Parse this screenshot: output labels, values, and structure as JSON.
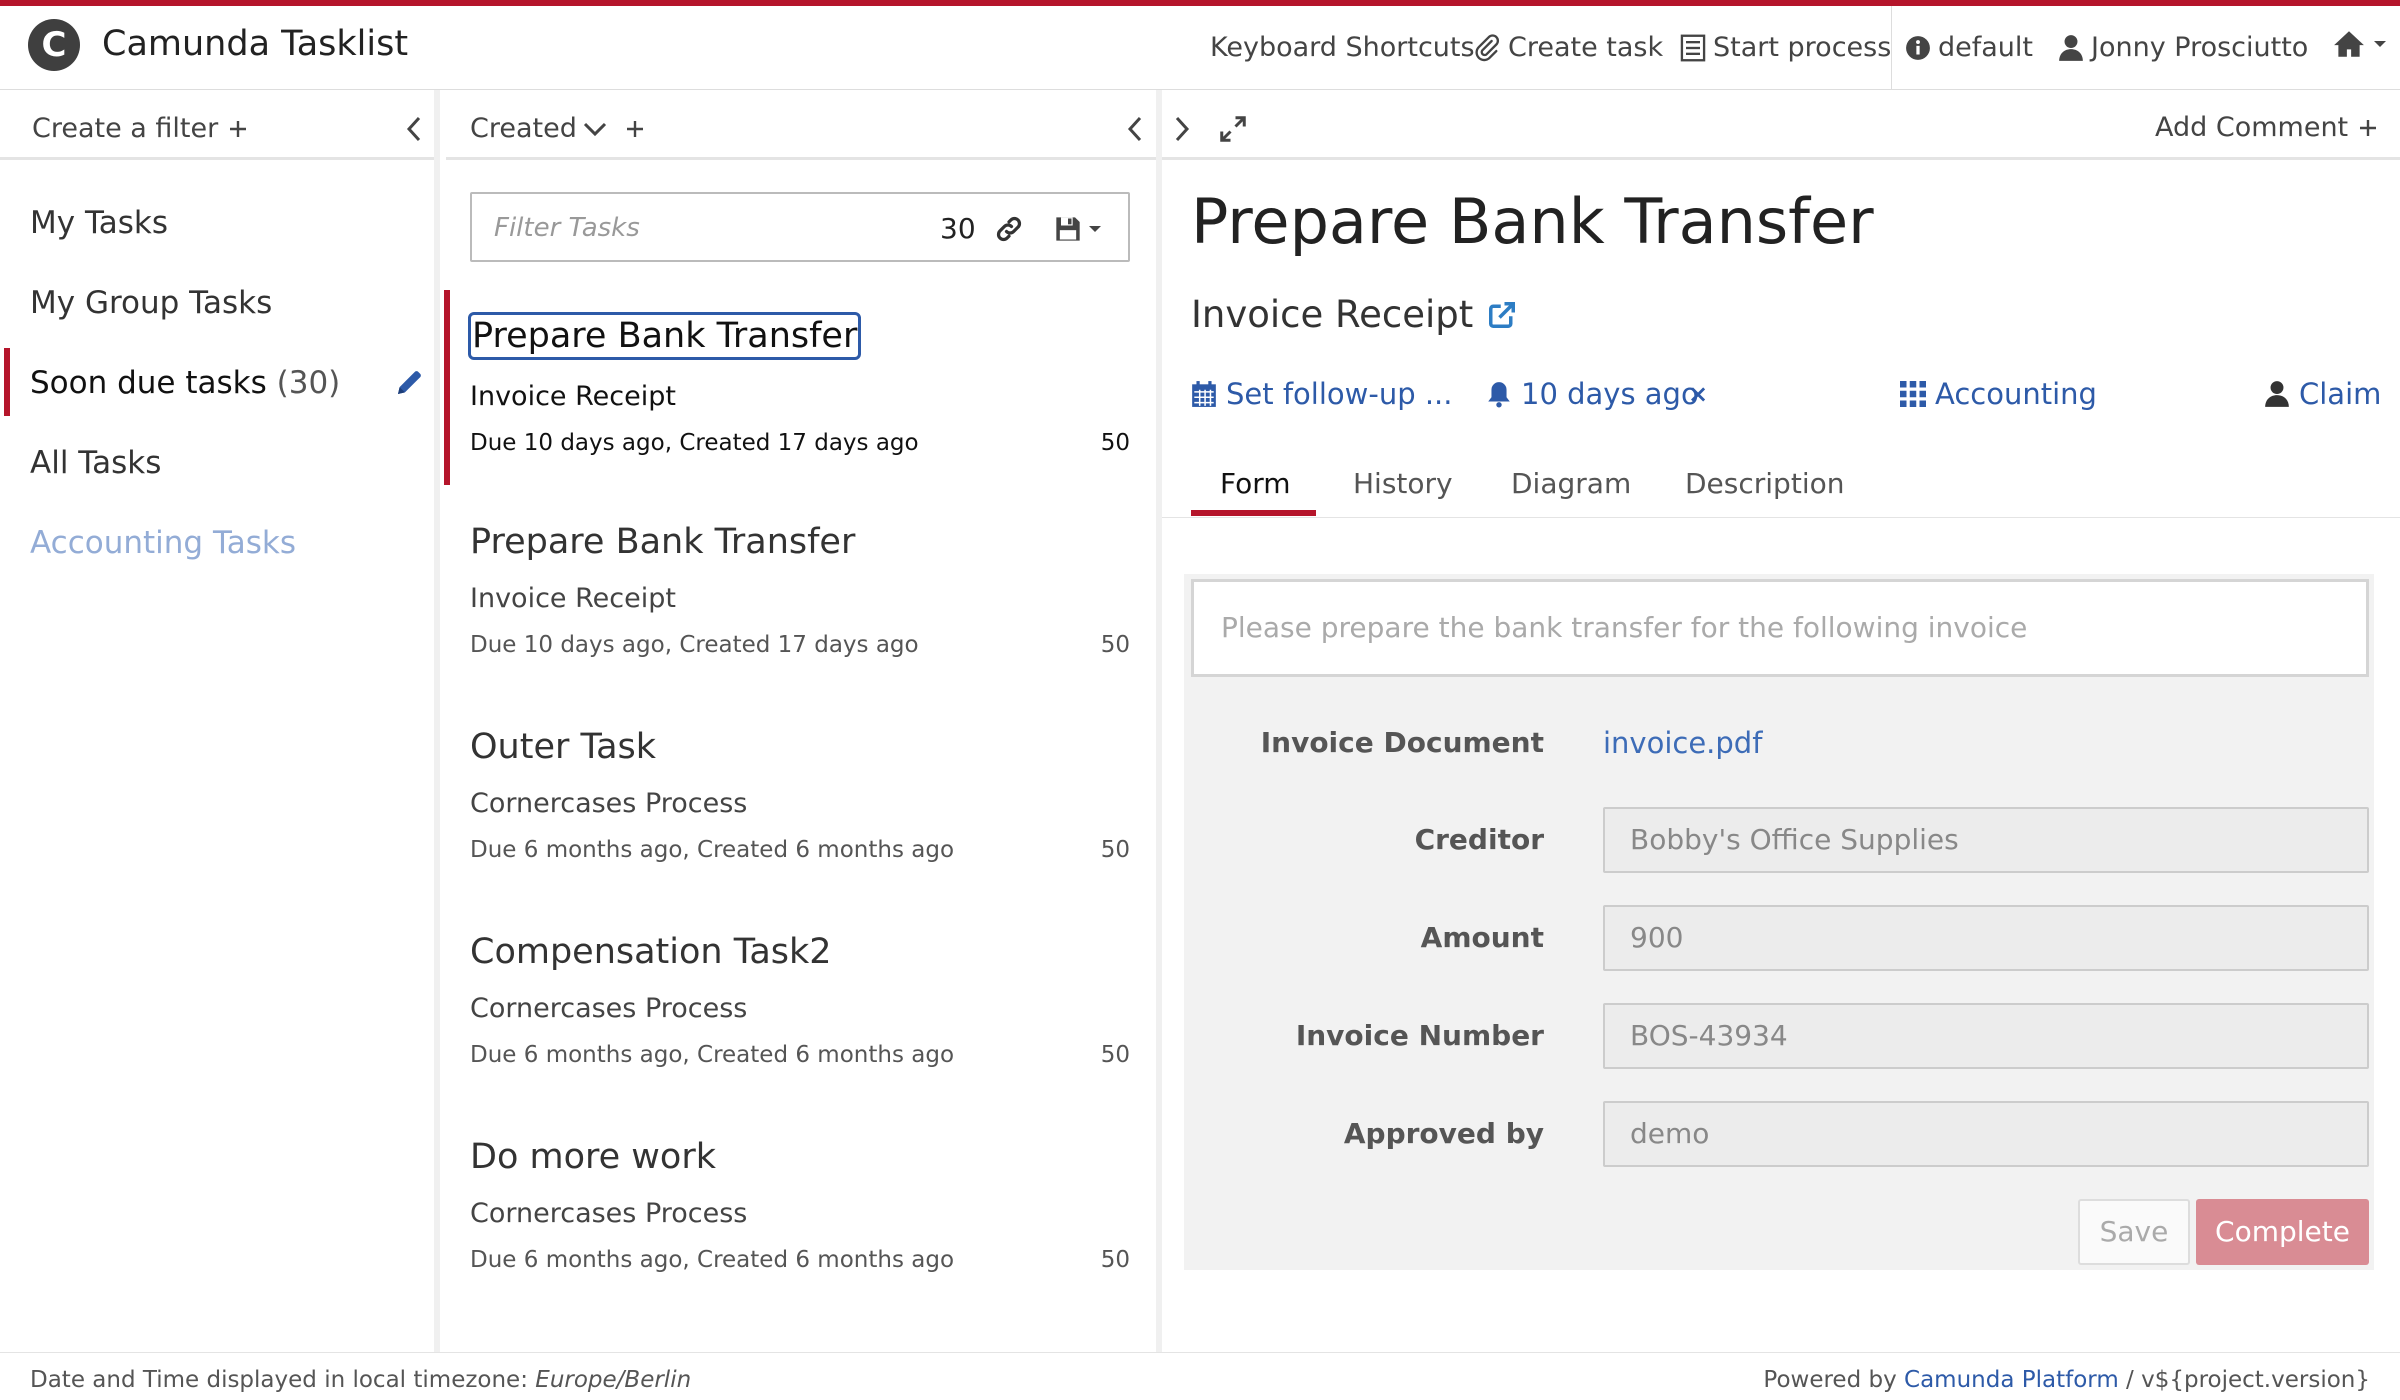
{
  "header": {
    "title": "Camunda Tasklist",
    "logo_letter": "C",
    "nav": {
      "keyboard_shortcuts": "Keyboard Shortcuts",
      "create_task": "Create task",
      "start_process": "Start process",
      "tenant": "default",
      "user": "Jonny Prosciutto"
    }
  },
  "filters": {
    "create_label": "Create a filter",
    "items": [
      {
        "label": "My Tasks"
      },
      {
        "label": "My Group Tasks"
      },
      {
        "label": "Soon due tasks",
        "count": "(30)"
      },
      {
        "label": "All Tasks"
      },
      {
        "label": "Accounting Tasks"
      }
    ]
  },
  "task_list": {
    "sort_label": "Created",
    "search_placeholder": "Filter Tasks",
    "count": "30",
    "tasks": [
      {
        "name": "Prepare Bank Transfer",
        "process": "Invoice Receipt",
        "due": "Due 10 days ago, Created 17 days ago",
        "priority": "50"
      },
      {
        "name": "Prepare Bank Transfer",
        "process": "Invoice Receipt",
        "due": "Due 10 days ago, Created 17 days ago",
        "priority": "50"
      },
      {
        "name": "Outer Task",
        "process": "Cornercases Process",
        "due": "Due 6 months ago, Created 6 months ago",
        "priority": "50"
      },
      {
        "name": "Compensation Task2",
        "process": "Cornercases Process",
        "due": "Due 6 months ago, Created 6 months ago",
        "priority": "50"
      },
      {
        "name": "Do more work",
        "process": "Cornercases Process",
        "due": "Due 6 months ago, Created 6 months ago",
        "priority": "50"
      }
    ]
  },
  "detail": {
    "add_comment": "Add Comment",
    "title": "Prepare Bank Transfer",
    "process": "Invoice Receipt",
    "follow_up": "Set follow-up ...",
    "due": "10 days ago",
    "remove_due": "×",
    "group": "Accounting",
    "claim": "Claim",
    "tabs": [
      "Form",
      "History",
      "Diagram",
      "Description"
    ],
    "active_tab": "Form"
  },
  "form": {
    "intro_placeholder": "Please prepare the bank transfer for the following invoice",
    "invoice_document_label": "Invoice Document",
    "invoice_document_link": "invoice.pdf",
    "fields": [
      {
        "label": "Creditor",
        "value": "Bobby's Office Supplies"
      },
      {
        "label": "Amount",
        "value": "900"
      },
      {
        "label": "Invoice Number",
        "value": "BOS-43934"
      },
      {
        "label": "Approved by",
        "value": "demo"
      }
    ],
    "save_label": "Save",
    "complete_label": "Complete"
  },
  "footer": {
    "timezone_prefix": "Date and Time displayed in local timezone: ",
    "timezone": "Europe/Berlin",
    "powered_by": "Powered by ",
    "platform_link": "Camunda Platform",
    "version": " / v${project.version}"
  },
  "colors": {
    "brand_red": "#b5152b",
    "link_blue": "#2d5aa8",
    "complete_button": "#d98c94"
  }
}
